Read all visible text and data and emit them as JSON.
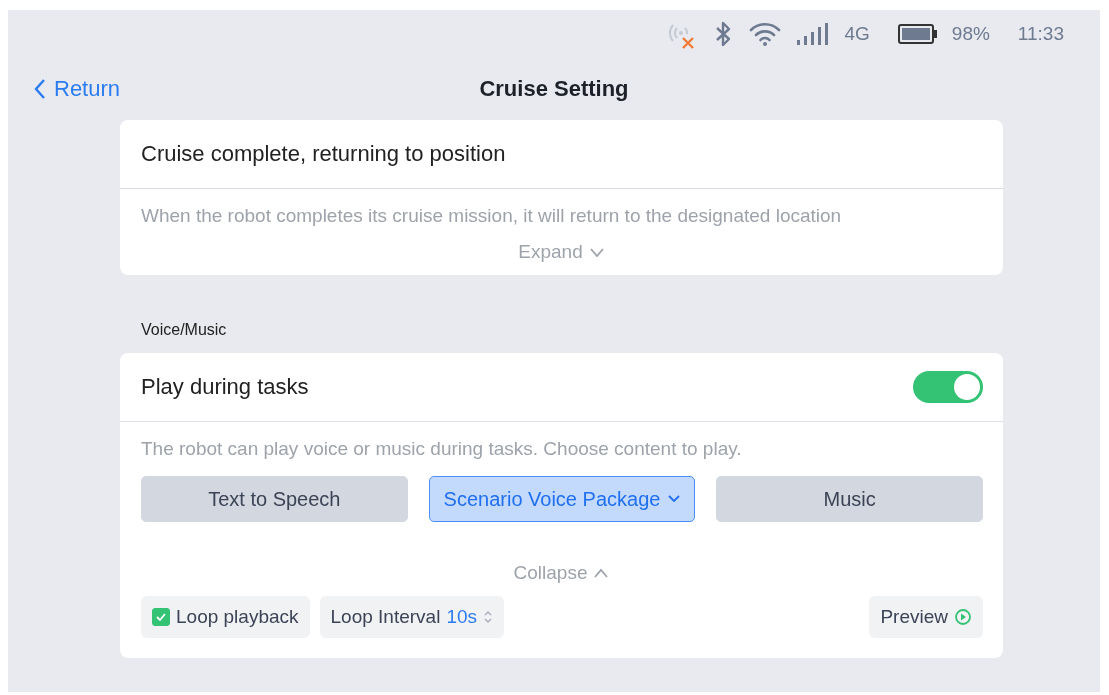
{
  "status_bar": {
    "network": "4G",
    "battery": "98%",
    "time": "11:33"
  },
  "header": {
    "back": "Return",
    "title": "Cruise Setting"
  },
  "return_card": {
    "title": "Cruise complete, returning to position",
    "description": "When the robot completes its cruise mission, it will return to the designated location",
    "expand": "Expand"
  },
  "section_label": "Voice/Music",
  "voice_card": {
    "title": "Play during tasks",
    "on": true,
    "description": "The robot can play voice or music during tasks. Choose content to play.",
    "options": [
      {
        "label": "Text to Speech",
        "selected": false,
        "dropdown": false
      },
      {
        "label": "Scenario Voice Package",
        "selected": true,
        "dropdown": true
      },
      {
        "label": "Music",
        "selected": false,
        "dropdown": false
      }
    ],
    "collapse": "Collapse",
    "loop_playback": {
      "label": "Loop playback",
      "checked": true
    },
    "loop_interval": {
      "label": "Loop Interval",
      "value": "10s"
    },
    "preview": "Preview"
  }
}
